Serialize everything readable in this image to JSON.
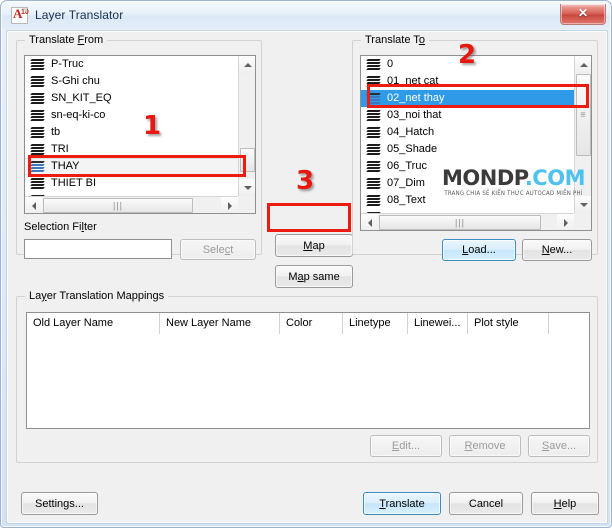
{
  "window": {
    "title": "Layer Translator",
    "icon": "autocad-a-icon",
    "close_label": "✕"
  },
  "translate_from": {
    "legend_pre": "Translate ",
    "legend_accel": "F",
    "legend_post": "rom",
    "items": [
      {
        "label": "P-Truc",
        "state": "normal"
      },
      {
        "label": "S-Ghi chu",
        "state": "normal"
      },
      {
        "label": "SN_KIT_EQ",
        "state": "normal"
      },
      {
        "label": "sn-eq-ki-co",
        "state": "normal"
      },
      {
        "label": "tb",
        "state": "normal"
      },
      {
        "label": "TRI",
        "state": "normal"
      },
      {
        "label": "THAY",
        "state": "selected-soft"
      },
      {
        "label": "THIET BI",
        "state": "normal"
      },
      {
        "label": "",
        "state": "clipped"
      }
    ]
  },
  "selection_filter": {
    "label_pre": "Selection Fi",
    "label_accel": "l",
    "label_post": "ter",
    "value": "",
    "placeholder": "",
    "select_pre": "Sele",
    "select_accel": "c",
    "select_post": "t",
    "select_enabled": false
  },
  "map_buttons": {
    "map_pre": "",
    "map_accel": "M",
    "map_post": "ap",
    "map_same_pre": "M",
    "map_same_accel": "a",
    "map_same_post": "p same"
  },
  "translate_to": {
    "legend_pre": "Translate T",
    "legend_accel": "o",
    "legend_post": "",
    "items": [
      {
        "label": "0",
        "state": "normal"
      },
      {
        "label": "01_net cat",
        "state": "normal"
      },
      {
        "label": "02_net thay",
        "state": "selected"
      },
      {
        "label": "03_noi that",
        "state": "normal"
      },
      {
        "label": "04_Hatch",
        "state": "normal"
      },
      {
        "label": "05_Shade",
        "state": "normal"
      },
      {
        "label": "06_Truc",
        "state": "normal"
      },
      {
        "label": "07_Dim",
        "state": "normal"
      },
      {
        "label": "08_Text",
        "state": "normal"
      },
      {
        "label": "",
        "state": "clipped"
      }
    ],
    "load_pre": "",
    "load_accel": "L",
    "load_post": "oad...",
    "new_pre": "",
    "new_accel": "N",
    "new_post": "ew..."
  },
  "mappings": {
    "legend_pre": "La",
    "legend_accel": "y",
    "legend_post": "er Translation Mappings",
    "columns": [
      {
        "label": "Old Layer Name",
        "width": 133
      },
      {
        "label": "New Layer Name",
        "width": 120
      },
      {
        "label": "Color",
        "width": 63
      },
      {
        "label": "Linetype",
        "width": 65
      },
      {
        "label": "Linewei...",
        "width": 60
      },
      {
        "label": "Plot style",
        "width": 81
      },
      {
        "label": "",
        "width": 45
      }
    ],
    "rows": [],
    "edit_pre": "",
    "edit_accel": "E",
    "edit_post": "dit...",
    "remove_pre": "",
    "remove_accel": "R",
    "remove_post": "emove",
    "save_pre": "",
    "save_accel": "S",
    "save_post": "ave..."
  },
  "footer": {
    "settings_pre": "Settin",
    "settings_accel": "g",
    "settings_post": "s...",
    "translate_pre": "",
    "translate_accel": "T",
    "translate_post": "ranslate",
    "cancel": "Cancel",
    "help_pre": "",
    "help_accel": "H",
    "help_post": "elp"
  },
  "watermark": {
    "brand": "MONDP",
    "tld": ".COM",
    "tagline": "TRANG CHIA SẺ KIẾN THỨC AUTOCAD MIỄN PHÍ",
    "brand_color": "#3b3b3b",
    "tld_color": "#4ec1ef"
  },
  "annotations": {
    "color": "#ee1b11",
    "markers": [
      {
        "num": "1",
        "target": "translate-from-thay-row"
      },
      {
        "num": "2",
        "target": "translate-to-02-net-thay-row"
      },
      {
        "num": "3",
        "target": "map-button"
      }
    ]
  }
}
